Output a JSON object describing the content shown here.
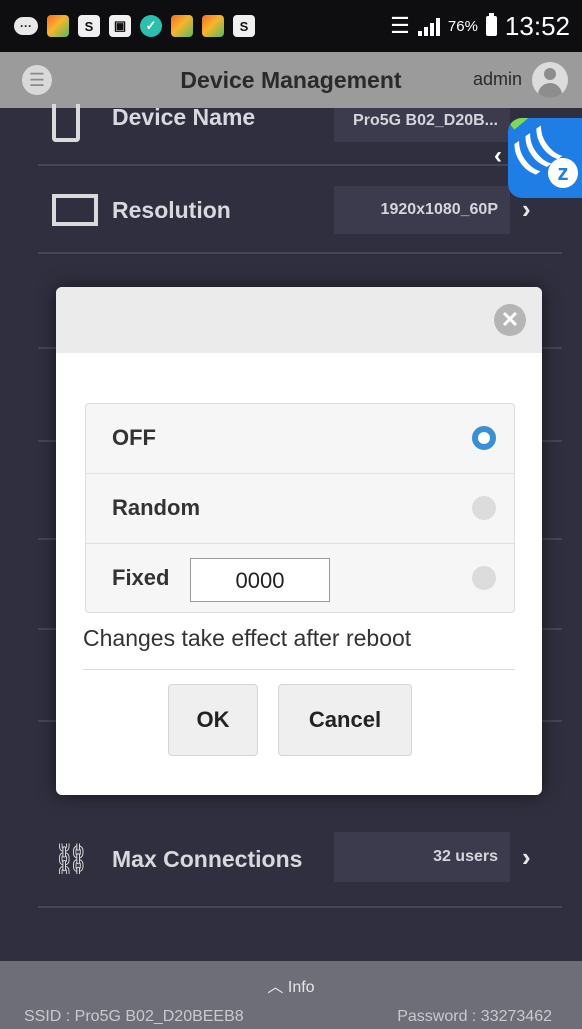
{
  "status_bar": {
    "battery_percent": "76%",
    "time": "13:52"
  },
  "header": {
    "title": "Device Management",
    "user": "admin"
  },
  "rows": [
    {
      "label": "Device Name",
      "value": "Pro5G B02_D20B..."
    },
    {
      "label": "Resolution",
      "value": "1920x1080_60P"
    },
    {
      "label": "Max Connections",
      "value": "32 users"
    }
  ],
  "dialog": {
    "options": [
      {
        "label": "OFF",
        "selected": true
      },
      {
        "label": "Random",
        "selected": false
      },
      {
        "label": "Fixed",
        "selected": false
      }
    ],
    "fixed_value": "0000",
    "note": "Changes take effect after reboot",
    "ok_label": "OK",
    "cancel_label": "Cancel"
  },
  "info_bar": {
    "toggle_label": "Info",
    "ssid": "SSID : Pro5G B02_D20BEEB8",
    "password": "Password : 33273462"
  },
  "colors": {
    "background": "#2f2f3f",
    "header": "#9b9b9b",
    "radio_selected": "#3a8fd6",
    "floating_badge": "#1f7ee6"
  },
  "icons": [
    "menu-icon",
    "avatar-icon",
    "phone-icon",
    "monitor-icon",
    "network-tree-icon",
    "close-icon",
    "chevron-right-icon",
    "chevron-up-icon",
    "wifi-icon",
    "signal-icon",
    "battery-icon"
  ]
}
